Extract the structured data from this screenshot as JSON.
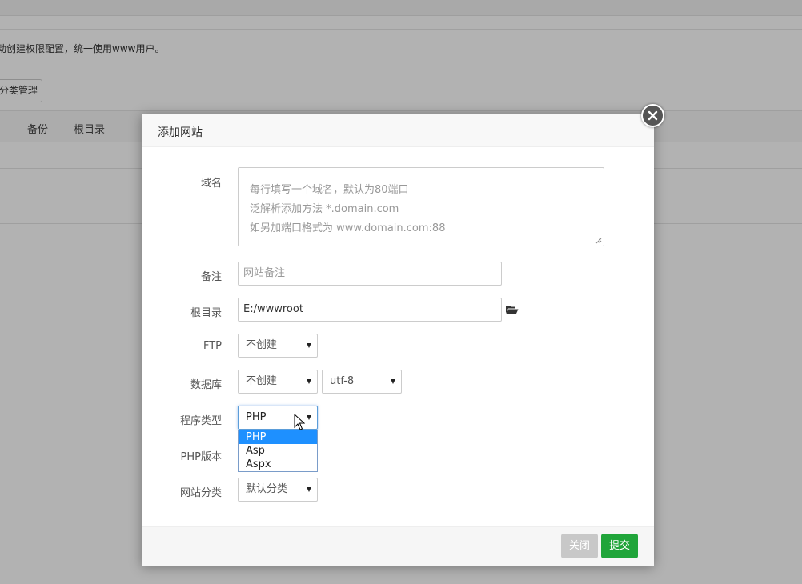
{
  "background": {
    "notice_text": "动创建权限配置，统一使用www用户。",
    "category_button": "分类管理",
    "columns": [
      "备份",
      "根目录"
    ]
  },
  "dialog": {
    "title": "添加网站",
    "fields": {
      "domain": {
        "label": "域名",
        "placeholder_lines": [
          "每行填写一个域名，默认为80端口",
          "泛解析添加方法 *.domain.com",
          "如另加端口格式为 www.domain.com:88"
        ]
      },
      "remark": {
        "label": "备注",
        "placeholder": "网站备注"
      },
      "root": {
        "label": "根目录",
        "value": "E:/wwwroot"
      },
      "ftp": {
        "label": "FTP",
        "value": "不创建"
      },
      "database": {
        "label": "数据库",
        "value": "不创建",
        "charset": "utf-8"
      },
      "program_type": {
        "label": "程序类型",
        "value": "PHP",
        "options": [
          "PHP",
          "Asp",
          "Aspx"
        ],
        "highlighted": "PHP"
      },
      "php_version": {
        "label": "PHP版本"
      },
      "category": {
        "label": "网站分类",
        "value": "默认分类"
      }
    },
    "buttons": {
      "close": "关闭",
      "submit": "提交"
    }
  },
  "colors": {
    "submit": "#20a53a",
    "close": "#c8c8c8",
    "highlight": "#1e90ff"
  }
}
